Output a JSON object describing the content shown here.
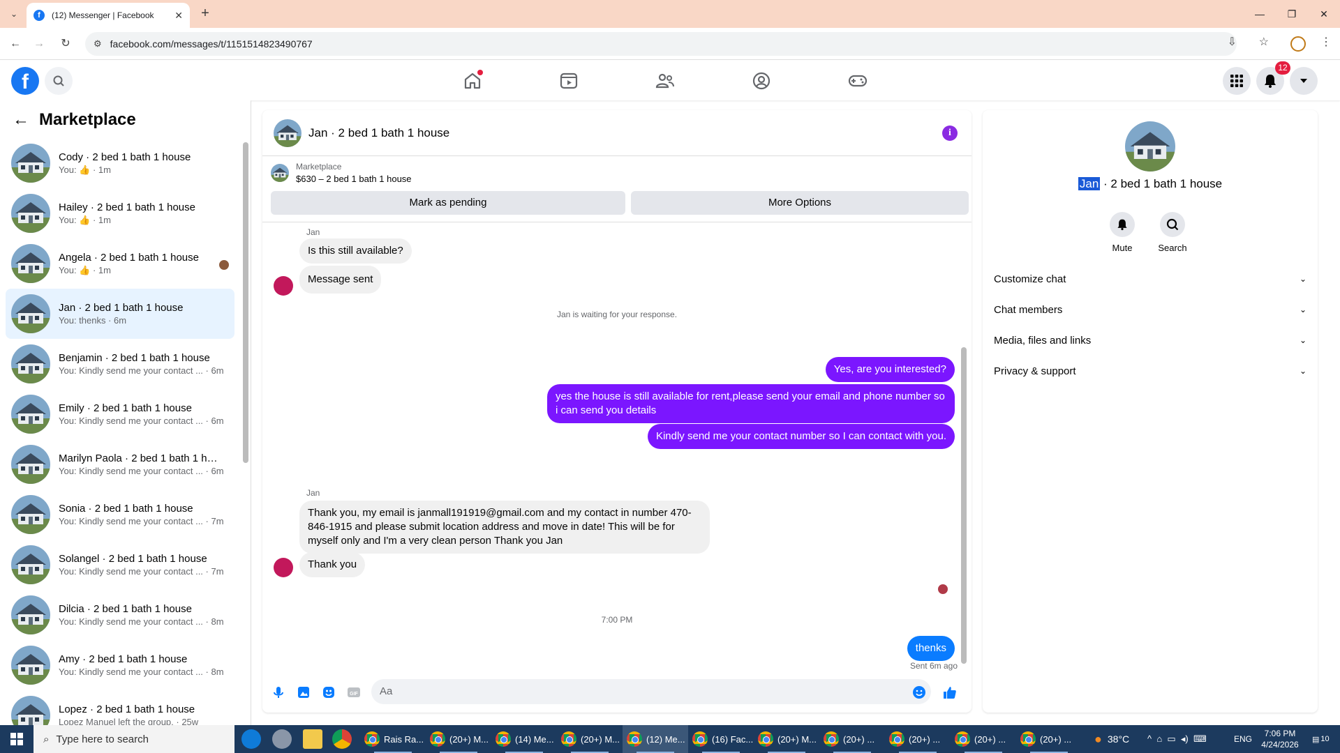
{
  "browser": {
    "tab_title": "(12) Messenger | Facebook",
    "url": "facebook.com/messages/t/1151514823490767"
  },
  "fbnav": {
    "notification_count": "12",
    "icons": [
      "home-icon",
      "video-icon",
      "friends-icon",
      "profile-icon",
      "gaming-icon"
    ]
  },
  "left": {
    "title": "Marketplace",
    "conversations": [
      {
        "name": "Cody · 2 bed 1 bath 1 house",
        "sub": "You: ",
        "thumb": true,
        "time": " · 1m"
      },
      {
        "name": "Hailey · 2 bed 1 bath 1 house",
        "sub": "You: ",
        "thumb": true,
        "time": " · 1m"
      },
      {
        "name": "Angela · 2 bed 1 bath 1 house",
        "sub": "You: ",
        "thumb": true,
        "time": " · 1m"
      },
      {
        "name": "Jan · 2 bed 1 bath 1 house",
        "sub": "You: thenks · 6m"
      },
      {
        "name": "Benjamin · 2 bed 1 bath 1 house",
        "sub": "You: Kindly send me your contact ... · 6m"
      },
      {
        "name": "Emily · 2 bed 1 bath 1 house",
        "sub": "You: Kindly send me your contact ... · 6m"
      },
      {
        "name": "Marilyn Paola · 2 bed 1 bath 1 ho...",
        "sub": "You: Kindly send me your contact ... · 6m"
      },
      {
        "name": "Sonia · 2 bed 1 bath 1 house",
        "sub": "You: Kindly send me your contact ... · 7m"
      },
      {
        "name": "Solangel · 2 bed 1 bath 1 house",
        "sub": "You: Kindly send me your contact ... · 7m"
      },
      {
        "name": "Dilcia · 2 bed 1 bath 1 house",
        "sub": "You: Kindly send me your contact ... · 8m"
      },
      {
        "name": "Amy · 2 bed 1 bath 1 house",
        "sub": "You: Kindly send me your contact ... · 8m"
      },
      {
        "name": "Lopez · 2 bed 1 bath 1 house",
        "sub": "Lopez Manuel left the group. · 25w"
      }
    ]
  },
  "chat": {
    "title": "Jan · 2 bed 1 bath 1 house",
    "listing_label": "Marketplace",
    "listing_desc": "$630 – 2 bed 1 bath 1 house",
    "mark_pending": "Mark as pending",
    "more_options": "More Options",
    "sender1": "Jan",
    "msg1": "Is this still available?",
    "msg2": "Message sent",
    "waiting": "Jan is waiting for your response.",
    "out1": "Yes, are you interested?",
    "out2": "yes the house is still available for rent,please send your email and phone number so i can send you details",
    "out3": "Kindly send me your contact number so I can contact with you.",
    "sender2": "Jan",
    "msg3": "Thank you, my email is janmall191919@gmail.com and my contact in number 470-846-1915 and please submit location address and move in date! This will be for myself only and I'm a very clean person Thank you Jan",
    "msg4": "Thank you",
    "timestamp": "7:00 PM",
    "out4": "thenks",
    "sent": "Sent 6m ago",
    "placeholder": "Aa"
  },
  "right": {
    "name_hl": "Jan",
    "name_rest": " · 2 bed 1 bath 1 house",
    "mute": "Mute",
    "search": "Search",
    "rows": [
      "Customize chat",
      "Chat members",
      "Media, files and links",
      "Privacy & support"
    ]
  },
  "taskbar": {
    "search_placeholder": "Type here to search",
    "apps": [
      "Rais Ra...",
      "(20+) M...",
      "(14) Me...",
      "(20+) M...",
      "(12) Me...",
      "(16) Fac...",
      "(20+) M...",
      "(20+) ...",
      "(20+) ...",
      "(20+) ...",
      "(20+) ..."
    ],
    "temp": "38°C",
    "lang": "ENG",
    "time": "7:06 PM",
    "date": "4/24/2026",
    "notif": "10"
  },
  "colors": {
    "fb_blue": "#1877f2",
    "outgoing_purple": "#7b16ff",
    "outgoing_blue": "#0a7cff",
    "active_conv": "#e7f3ff"
  }
}
